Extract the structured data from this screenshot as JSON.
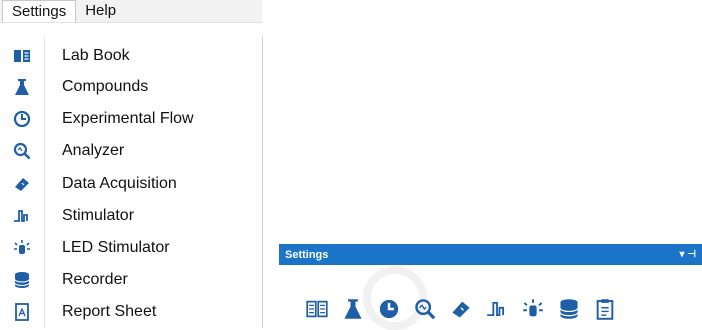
{
  "menubar": {
    "items": [
      {
        "label": "Settings",
        "active": true
      },
      {
        "label": "Help",
        "active": false
      }
    ]
  },
  "settings_menu": {
    "items": [
      {
        "label": "Lab Book",
        "icon": "book-icon"
      },
      {
        "label": "Compounds",
        "icon": "flask-icon"
      },
      {
        "label": "Experimental Flow",
        "icon": "clock-icon"
      },
      {
        "label": "Analyzer",
        "icon": "magnifier-icon"
      },
      {
        "label": "Data Acquisition",
        "icon": "probe-icon"
      },
      {
        "label": "Stimulator",
        "icon": "pulse-icon"
      },
      {
        "label": "LED Stimulator",
        "icon": "led-icon"
      },
      {
        "label": "Recorder",
        "icon": "database-icon"
      },
      {
        "label": "Report Sheet",
        "icon": "report-icon"
      }
    ]
  },
  "settings_panel": {
    "title": "Settings",
    "pin_label": "▾ ⊣"
  },
  "colors": {
    "icon_blue": "#1e5fa8",
    "titlebar_blue": "#1b74c8",
    "menu_bg": "#f2f2f2"
  }
}
